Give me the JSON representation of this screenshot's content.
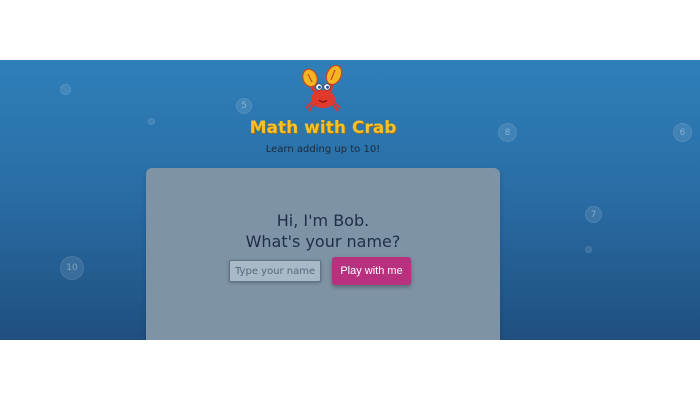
{
  "header": {
    "logo_icon": "crab-icon",
    "title": "Math with Crab",
    "subtitle": "Learn adding up to 10!"
  },
  "card": {
    "greeting_line1": "Hi, I'm Bob.",
    "greeting_line2": "What's your name?",
    "name_input": {
      "value": "",
      "placeholder": "Type your name..."
    },
    "play_button_label": "Play with me"
  },
  "bubbles": [
    "5",
    "8",
    "6",
    "7",
    "10"
  ],
  "colors": {
    "background_top": "#2f7fb9",
    "background_bottom": "#1f4f80",
    "title": "#f6c22b",
    "card": "#7e93a5",
    "play_button": "#b7317f"
  }
}
